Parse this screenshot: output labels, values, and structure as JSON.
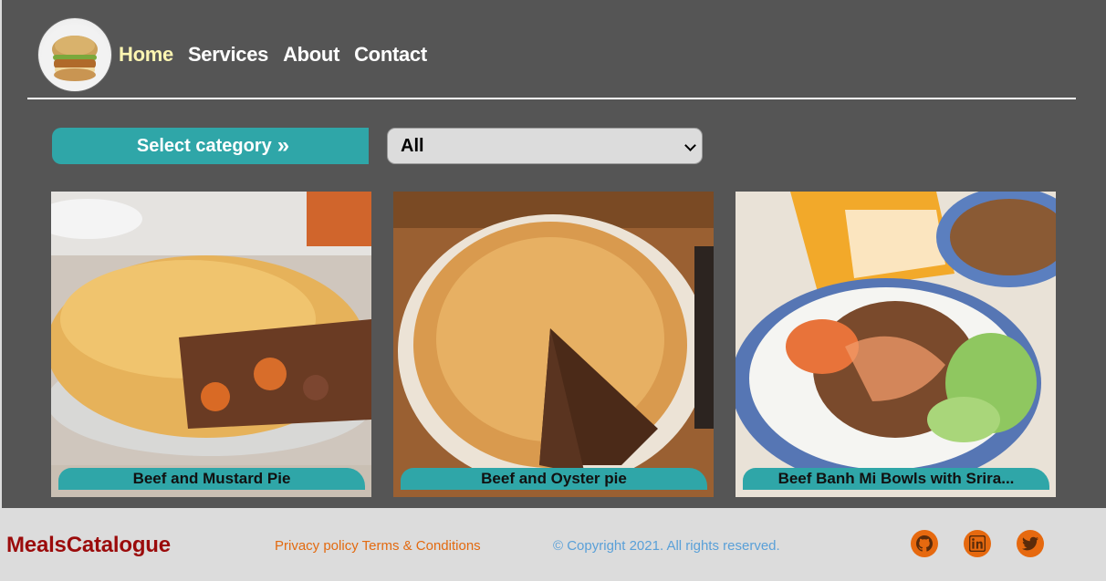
{
  "nav": {
    "logo_alt": "burger",
    "links": [
      {
        "label": "Home",
        "active": true
      },
      {
        "label": "Services",
        "active": false
      },
      {
        "label": "About",
        "active": false
      },
      {
        "label": "Contact",
        "active": false
      }
    ]
  },
  "filter": {
    "label": "Select category",
    "arrows": "»",
    "selected": "All"
  },
  "meals": [
    {
      "title": "Beef and Mustard Pie"
    },
    {
      "title": "Beef and Oyster pie"
    },
    {
      "title": "Beef Banh Mi Bowls with Srira..."
    }
  ],
  "footer": {
    "brand": "MealsCatalogue",
    "privacy": "Privacy policy",
    "terms": "Terms & Conditions",
    "copyright": "© Copyright 2021. All rights reserved.",
    "social": [
      "github-icon",
      "linkedin-icon",
      "twitter-icon"
    ]
  },
  "colors": {
    "background": "#555555",
    "accent": "#2fa6a8",
    "active_link": "#fdf6b2",
    "brand": "#9b0b0b",
    "footer_links": "#e36a10",
    "copyright": "#5aa0d8",
    "social": "#e6690f"
  }
}
